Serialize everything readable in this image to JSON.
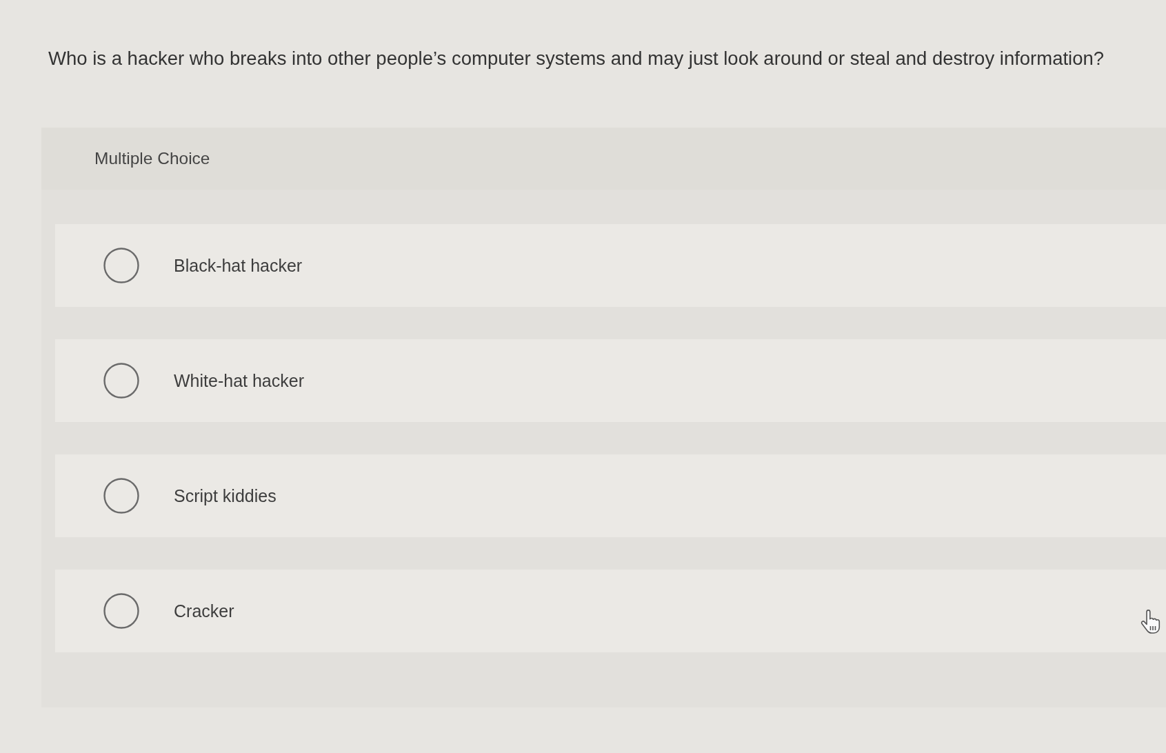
{
  "question": {
    "text": "Who is a hacker who breaks into other people’s computer systems and may just look around or steal and destroy information?"
  },
  "section": {
    "label": "Multiple Choice"
  },
  "options": [
    {
      "label": "Black-hat hacker",
      "selected": false
    },
    {
      "label": "White-hat hacker",
      "selected": false
    },
    {
      "label": "Script kiddies",
      "selected": false
    },
    {
      "label": "Cracker",
      "selected": false
    }
  ]
}
